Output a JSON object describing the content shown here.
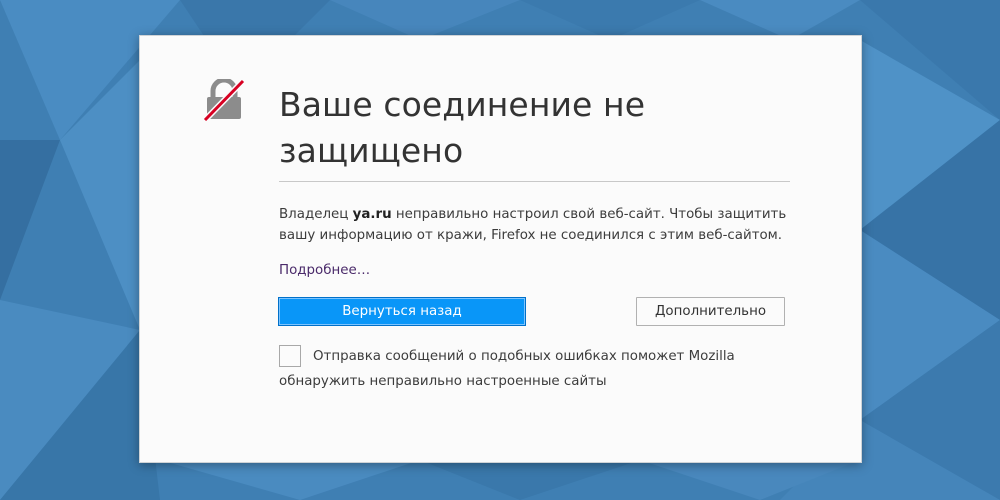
{
  "error_page": {
    "title": "Ваше соединение не защищено",
    "description_prefix": "Владелец ",
    "site": "ya.ru",
    "description_suffix": " неправильно настроил свой веб-сайт. Чтобы защитить вашу информацию от кражи, Firefox не соединился с этим веб-сайтом.",
    "learn_more_link": "Подробнее…",
    "back_button": "Вернуться назад",
    "advanced_button": "Дополнительно",
    "report_checkbox_label": "Отправка сообщений о подобных ошибках поможет Mozilla обнаружить неправильно настроенные сайты",
    "report_checked": false
  },
  "icons": {
    "warning": "broken-lock-icon"
  },
  "colors": {
    "background": "#3f7fb3",
    "card": "#fbfbfb",
    "primary_button": "#0996f8",
    "lock_gray": "#8c8c8c",
    "strike_red": "#d70022",
    "link": "#4a2a6a"
  }
}
